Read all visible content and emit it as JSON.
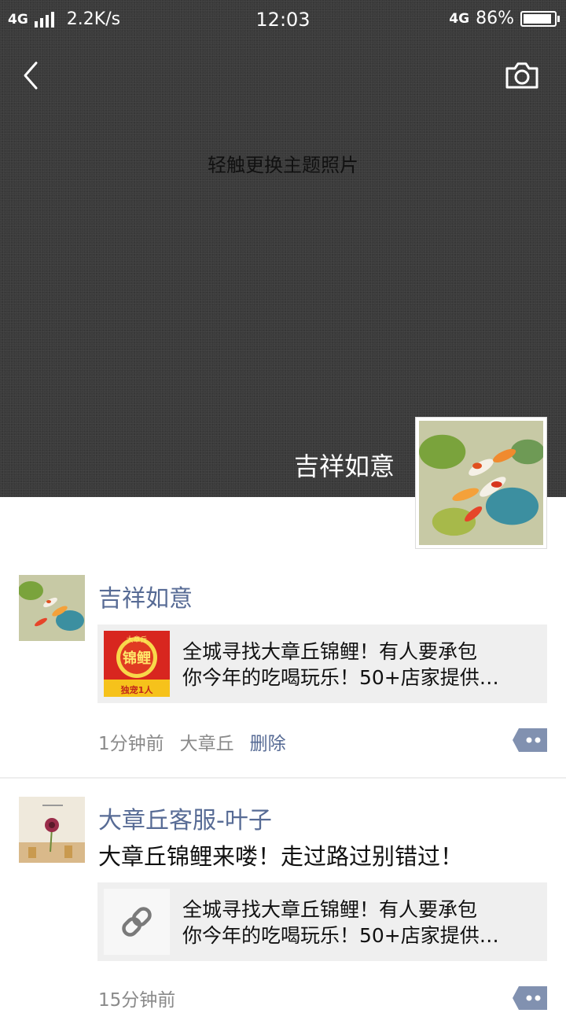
{
  "status_bar": {
    "network": "4G",
    "speed": "2.2K/s",
    "time": "12:03",
    "network_right": "4G",
    "battery": "86%"
  },
  "cover": {
    "hint": "轻触更换主题照片",
    "user_name": "吉祥如意"
  },
  "posts": [
    {
      "name": "吉祥如意",
      "card_line1": "全城寻找大章丘锦鲤！有人要承包",
      "card_line2": "你今年的吃喝玩乐！50+店家提供…",
      "thumb_top": "大章丘",
      "thumb_main": "锦鲤",
      "thumb_bottom": "独宠1人",
      "time": "1分钟前",
      "location": "大章丘",
      "delete": "删除"
    },
    {
      "name": "大章丘客服-叶子",
      "text": "大章丘锦鲤来喽！走过路过别错过！",
      "card_line1": "全城寻找大章丘锦鲤！有人要承包",
      "card_line2": "你今年的吃喝玩乐！50+店家提供…",
      "time": "15分钟前"
    }
  ],
  "colors": {
    "link": "#576b95",
    "cover": "#3b3b3b",
    "card": "#efefef"
  }
}
